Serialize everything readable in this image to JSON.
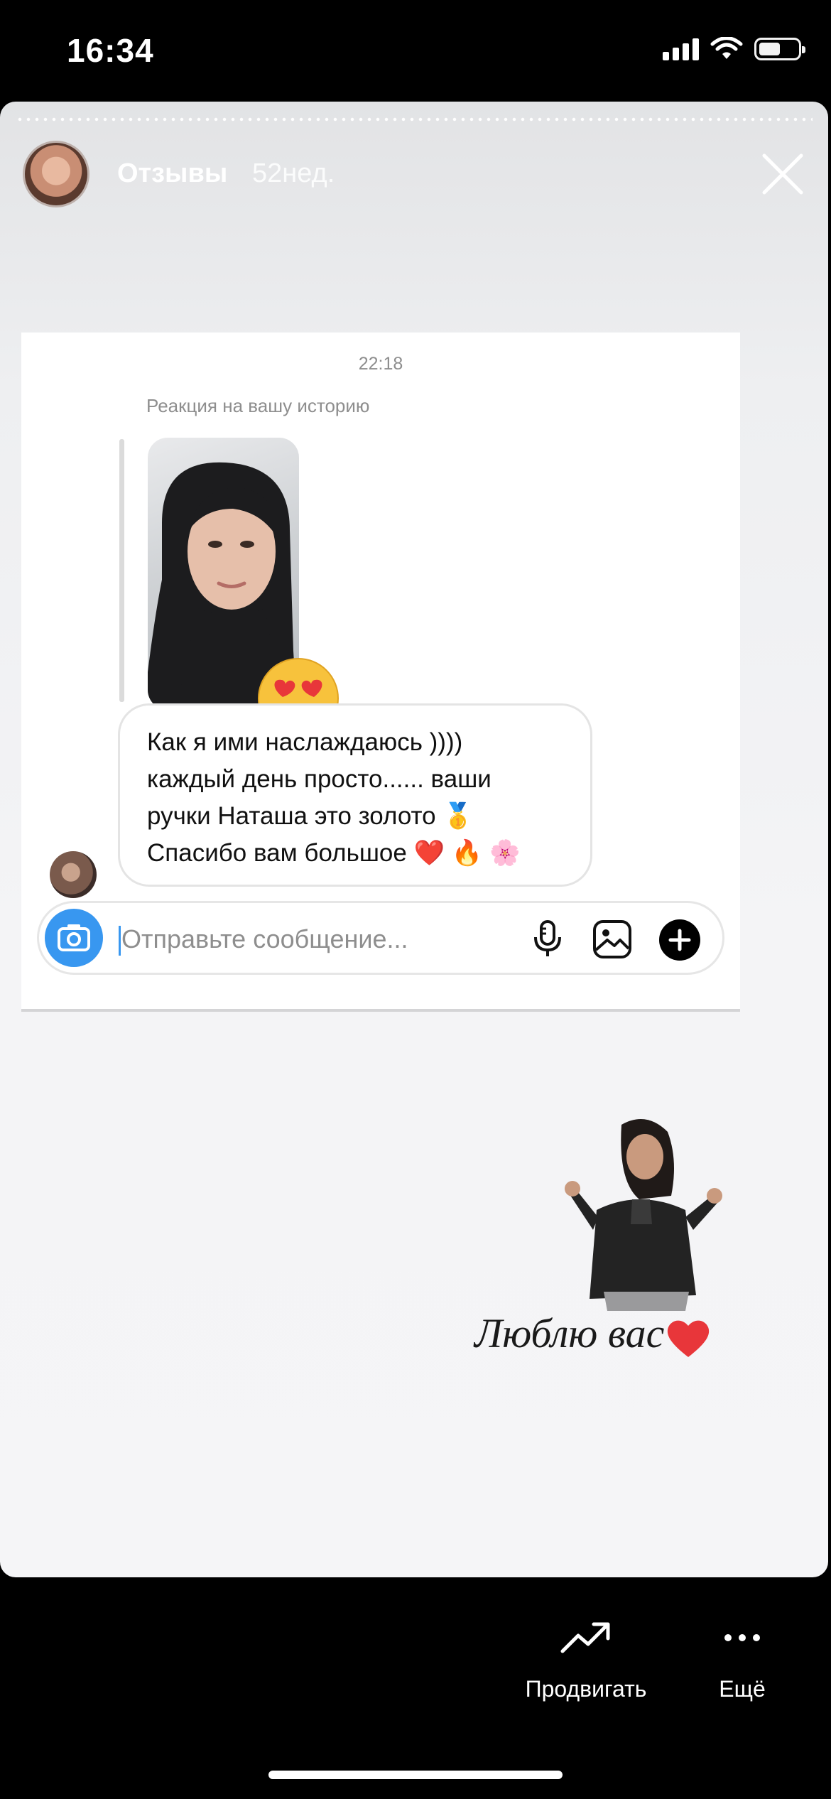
{
  "status_bar": {
    "time": "16:34",
    "battery_level": 0.55
  },
  "story": {
    "author_name": "Отзывы",
    "posted_ago": "52нед.",
    "close_icon": "close-icon"
  },
  "chat": {
    "timestamp": "22:18",
    "reaction_label": "Реакция на вашу историю",
    "reaction_emoji": "heart-eyes-emoji",
    "message_lines": [
      "Как я ими наслаждаюсь ))))",
      "каждый день просто...... ваши",
      "ручки Наташа это золото 🥇",
      "Спасибо вам большое ❤️ 🔥 🌸"
    ],
    "composer_placeholder": "Отправьте сообщение..."
  },
  "caption": {
    "text": "Люблю вас"
  },
  "bottom_bar": {
    "promote_label": "Продвигать",
    "more_label": "Ещё"
  },
  "colors": {
    "accent_blue": "#3897f0",
    "heart_red": "#e8363a"
  }
}
